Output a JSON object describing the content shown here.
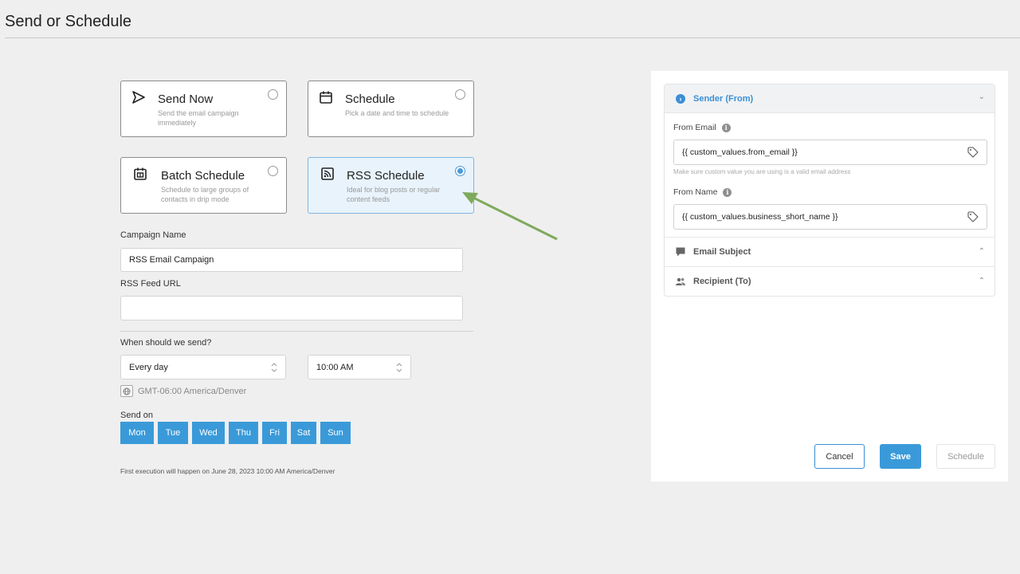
{
  "page": {
    "title": "Send or Schedule"
  },
  "options": [
    {
      "id": "send-now",
      "title": "Send Now",
      "desc": "Send the email campaign immediately",
      "icon": "send-icon",
      "selected": false
    },
    {
      "id": "schedule",
      "title": "Schedule",
      "desc": "Pick a date and time to schedule",
      "icon": "calendar-icon",
      "selected": false
    },
    {
      "id": "batch-schedule",
      "title": "Batch Schedule",
      "desc": "Schedule to large groups of contacts in drip mode",
      "icon": "batch-calendar-icon",
      "selected": false
    },
    {
      "id": "rss-schedule",
      "title": "RSS Schedule",
      "desc": "Ideal for blog posts or regular content feeds",
      "icon": "rss-icon",
      "selected": true
    }
  ],
  "form": {
    "campaign_name_label": "Campaign Name",
    "campaign_name_value": "RSS Email Campaign",
    "rss_url_label": "RSS Feed URL",
    "rss_url_value": "",
    "when_label": "When should we send?",
    "frequency": "Every day",
    "time": "10:00 AM",
    "timezone": "GMT-06:00 America/Denver",
    "send_on_label": "Send on",
    "days": [
      "Mon",
      "Tue",
      "Wed",
      "Thu",
      "Fri",
      "Sat",
      "Sun"
    ],
    "execution_note": "First execution will happen on June 28, 2023 10:00 AM America/Denver"
  },
  "panel": {
    "sender_header": "Sender (From)",
    "from_email_label": "From Email",
    "from_email_value": "{{ custom_values.from_email }}",
    "from_email_hint": "Make sure custom value you are using is a valid email address",
    "from_name_label": "From Name",
    "from_name_value": "{{ custom_values.business_short_name }}",
    "email_subject_label": "Email Subject",
    "recipient_label": "Recipient (To)",
    "cancel": "Cancel",
    "save": "Save",
    "schedule": "Schedule"
  },
  "colors": {
    "accent": "#3a9ad9",
    "selected_card_bg": "#e8f3fb",
    "annotation_arrow": "#7faa5d"
  }
}
